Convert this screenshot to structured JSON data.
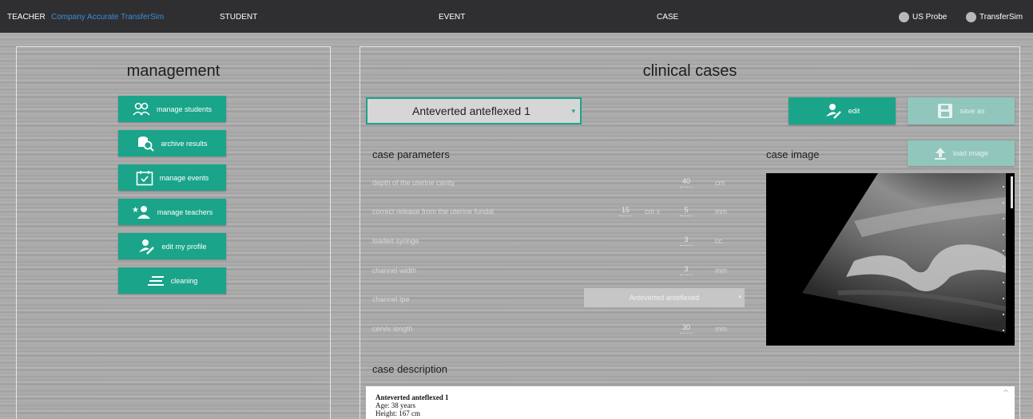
{
  "topbar": {
    "role": "TEACHER",
    "subtitle": "Company Accurate TransferSim",
    "nav": [
      "STUDENT",
      "EVENT",
      "CASE"
    ],
    "status": [
      {
        "label": "US Probe",
        "icon": "status-dot"
      },
      {
        "label": "TransferSim",
        "icon": "status-dot"
      }
    ]
  },
  "management": {
    "title": "management",
    "items": [
      {
        "label": "manage students",
        "icon": "users-icon"
      },
      {
        "label": "archive results",
        "icon": "archive-search-icon"
      },
      {
        "label": "manage events",
        "icon": "calendar-check-icon"
      },
      {
        "label": "manage teachers",
        "icon": "add-teacher-icon"
      },
      {
        "label": "edit my profile",
        "icon": "user-edit-icon"
      },
      {
        "label": "cleaning",
        "icon": "lines-icon"
      }
    ]
  },
  "clinical": {
    "title": "clinical cases",
    "selected_case": "Anteverted anteflexed 1",
    "edit_label": "edit",
    "save_as_label": "save as",
    "load_image_label": "load image",
    "params_title": "case parameters",
    "image_title": "case image",
    "params": {
      "depth_label": "depth of the uterine cavity",
      "depth_value": "40",
      "depth_unit": "cm",
      "release_label": "correct release from the uterine fundal",
      "release_value": "15",
      "release_pm_unit": "cm ±",
      "release_tolerance": "5",
      "release_unit": "mm",
      "syringe_label": "loaded syringe",
      "syringe_value": "3",
      "syringe_unit": "cc",
      "width_label": "channel width",
      "width_value": "3",
      "width_unit": "mm",
      "type_label": "channel tpe",
      "type_value": "Anteverted anteflexed",
      "cervix_label": "cervix length",
      "cervix_value": "30",
      "cervix_unit": "mm"
    },
    "description_title": "case description",
    "description_lines": [
      "Anteverted anteflexed 1",
      "Age: 38 years",
      "Height: 167 cm"
    ]
  },
  "colors": {
    "accent": "#1aa48a",
    "topbar": "#2f2f31",
    "subtitle": "#3c8dd8"
  }
}
